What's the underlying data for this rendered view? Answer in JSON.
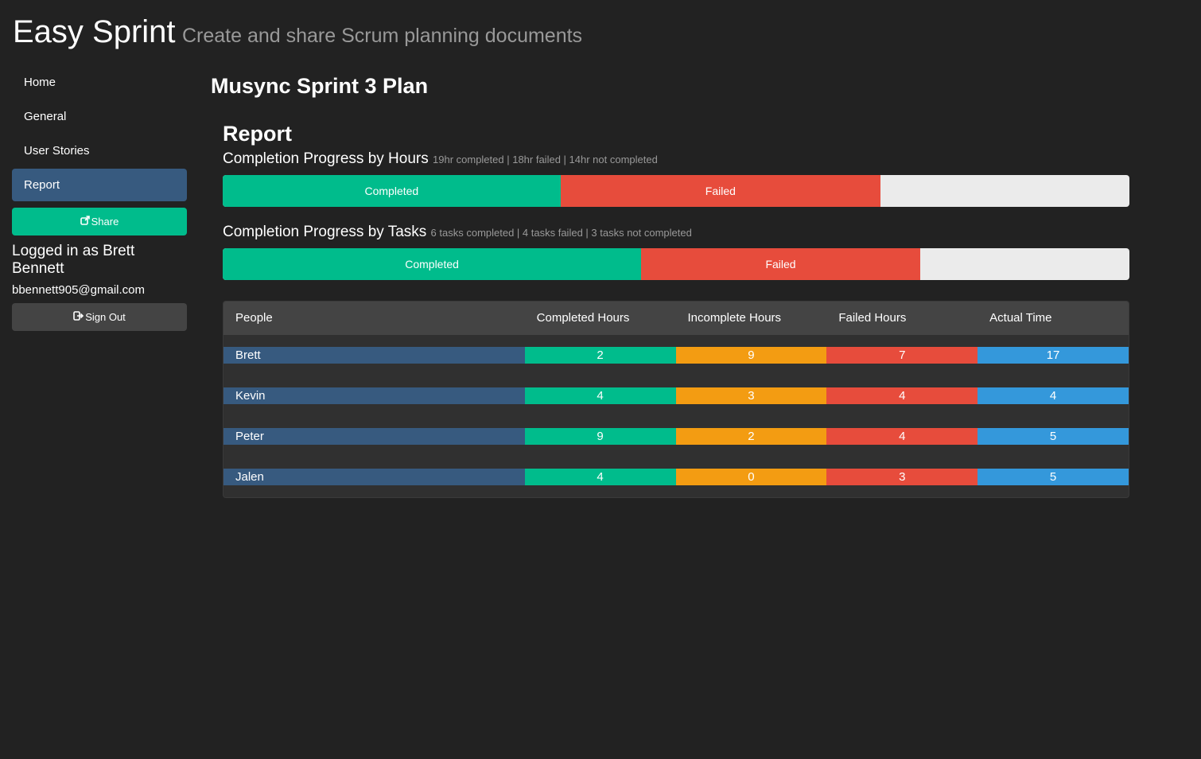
{
  "header": {
    "title": "Easy Sprint",
    "tagline": "Create and share Scrum planning documents"
  },
  "sidebar": {
    "items": [
      {
        "label": "Home",
        "active": false
      },
      {
        "label": "General",
        "active": false
      },
      {
        "label": "User Stories",
        "active": false
      },
      {
        "label": "Report",
        "active": true
      }
    ],
    "share_label": "Share",
    "share_icon": "share-icon",
    "logged_in_text": "Logged in as Brett Bennett",
    "email": "bbennett905@gmail.com",
    "signout_label": "Sign Out",
    "signout_icon": "sign-out-icon"
  },
  "main": {
    "sprint_title": "Musync Sprint 3 Plan",
    "report_title": "Report",
    "hours_progress": {
      "heading": "Completion Progress by Hours",
      "note": "19hr completed | 18hr failed | 14hr not completed",
      "completed_label": "Completed",
      "failed_label": "Failed",
      "completed": 19,
      "failed": 18,
      "not_completed": 14
    },
    "tasks_progress": {
      "heading": "Completion Progress by Tasks",
      "note": "6 tasks completed | 4 tasks failed | 3 tasks not completed",
      "completed_label": "Completed",
      "failed_label": "Failed",
      "completed": 6,
      "failed": 4,
      "not_completed": 3
    },
    "table": {
      "headers": [
        "People",
        "Completed Hours",
        "Incomplete Hours",
        "Failed Hours",
        "Actual Time"
      ],
      "rows": [
        {
          "name": "Brett",
          "completed": "2",
          "incomplete": "9",
          "failed": "7",
          "actual": "17"
        },
        {
          "name": "Kevin",
          "completed": "4",
          "incomplete": "3",
          "failed": "4",
          "actual": "4"
        },
        {
          "name": "Peter",
          "completed": "9",
          "incomplete": "2",
          "failed": "4",
          "actual": "5"
        },
        {
          "name": "Jalen",
          "completed": "4",
          "incomplete": "0",
          "failed": "3",
          "actual": "5"
        }
      ]
    }
  },
  "colors": {
    "background": "#222222",
    "primary": "#375a7f",
    "success": "#00bc8c",
    "warning": "#f39c12",
    "danger": "#e74c3c",
    "info": "#3498db",
    "muted": "#999999"
  }
}
